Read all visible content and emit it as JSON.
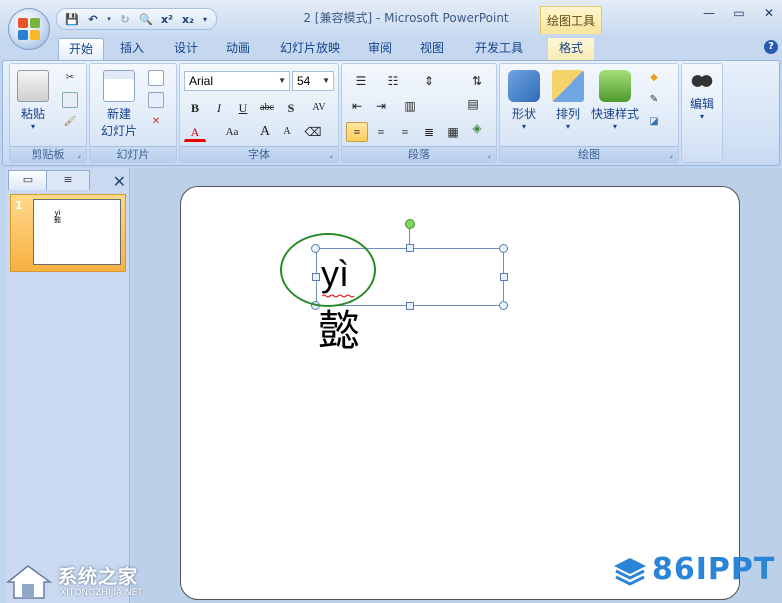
{
  "window": {
    "title": "2 [兼容模式] - Microsoft PowerPoint",
    "context_tab_title": "绘图工具",
    "controls": [
      "—",
      "▭",
      "✕"
    ]
  },
  "quick_access": {
    "items": [
      "save",
      "undo",
      "redo",
      "print-preview",
      "superscript",
      "subscript",
      "customize"
    ],
    "superscript_label": "x²",
    "subscript_label": "x₂"
  },
  "tabs": [
    "开始",
    "插入",
    "设计",
    "动画",
    "幻灯片放映",
    "审阅",
    "视图",
    "开发工具",
    "格式"
  ],
  "active_tab": "开始",
  "ribbon": {
    "clipboard": {
      "label": "剪贴板",
      "paste": "粘贴"
    },
    "slides": {
      "label": "幻灯片",
      "new_slide_line1": "新建",
      "new_slide_line2": "幻灯片"
    },
    "font": {
      "label": "字体",
      "font_name": "Arial",
      "font_size": "54",
      "bold": "B",
      "italic": "I",
      "underline": "U",
      "strike": "abc",
      "shadow": "S",
      "spacing": "AV",
      "color": "A",
      "case": "Aa",
      "grow": "A",
      "shrink": "A"
    },
    "paragraph": {
      "label": "段落"
    },
    "drawing": {
      "label": "绘图",
      "shapes": "形状",
      "arrange": "排列",
      "quick_styles": "快速样式"
    },
    "editing": {
      "label": "编辑",
      "find_label": "编辑"
    }
  },
  "slides_pane": {
    "slide_number": "1",
    "thumb_line1": "yì",
    "thumb_line2": "懿"
  },
  "slide": {
    "pinyin": "yì",
    "character": "懿"
  },
  "watermarks": {
    "left_zh": "系统之家",
    "left_en": "XITONGZHIJIA.NET",
    "right": "86IPPT"
  },
  "colors": {
    "accent": "#15428b",
    "ribbon_bg": "#d3e2f5",
    "selection_outline": "#6d8fc4",
    "annotation_circle": "#2a8a2a",
    "active_thumb": "#f8b042"
  }
}
